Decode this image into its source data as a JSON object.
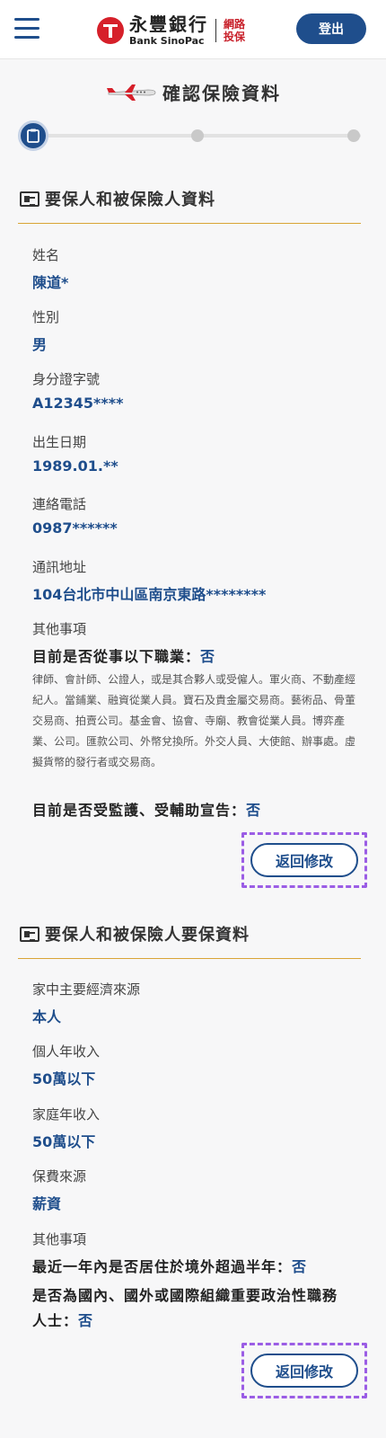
{
  "header": {
    "bank_name_cn": "永豐銀行",
    "bank_name_en": "Bank SinoPac",
    "channel_label": "網路投保",
    "logout_label": "登出"
  },
  "page": {
    "title": "確認保險資料"
  },
  "section1": {
    "title": "要保人和被保險人資料",
    "fields": [
      {
        "label": "姓名",
        "value": "陳道*"
      },
      {
        "label": "性別",
        "value": "男"
      },
      {
        "label": "身分證字號",
        "value": "A12345****"
      },
      {
        "label": "出生日期",
        "value": "1989.01.**"
      },
      {
        "label": "連絡電話",
        "value": "0987******"
      },
      {
        "label": "通訊地址",
        "value": "104台北市中山區南京東路********"
      }
    ],
    "other_label": "其他事項",
    "q1_text": "目前是否從事以下職業：",
    "q1_answer": "否",
    "q1_note": "律師、會計師、公證人，或是其合夥人或受僱人。軍火商、不動產經紀人。當鋪業、融資從業人員。寶石及貴金屬交易商。藝術品、骨董交易商、拍賣公司。基金會、協會、寺廟、教會從業人員。博弈產業、公司。匯款公司、外幣兌換所。外交人員、大使館、辦事處。虛擬貨幣的發行者或交易商。",
    "q2_text": "目前是否受監護、受輔助宣告：",
    "q2_answer": "否",
    "edit_label": "返回修改"
  },
  "section2": {
    "title": "要保人和被保險人要保資料",
    "fields": [
      {
        "label": "家中主要經濟來源",
        "value": "本人"
      },
      {
        "label": "個人年收入",
        "value": "50萬以下"
      },
      {
        "label": "家庭年收入",
        "value": "50萬以下"
      },
      {
        "label": "保費來源",
        "value": "薪資"
      }
    ],
    "other_label": "其他事項",
    "q1_text": "最近一年內是否居住於境外超過半年：",
    "q1_answer": "否",
    "q2_text_line1": "是否為國內、國外或國際組織重要政治性職務",
    "q2_text_line2": "人士：",
    "q2_answer": "否",
    "edit_label": "返回修改"
  },
  "colors": {
    "brand_blue": "#1f4e8c",
    "brand_red": "#d6202a",
    "divider_gold": "#d9a436"
  }
}
